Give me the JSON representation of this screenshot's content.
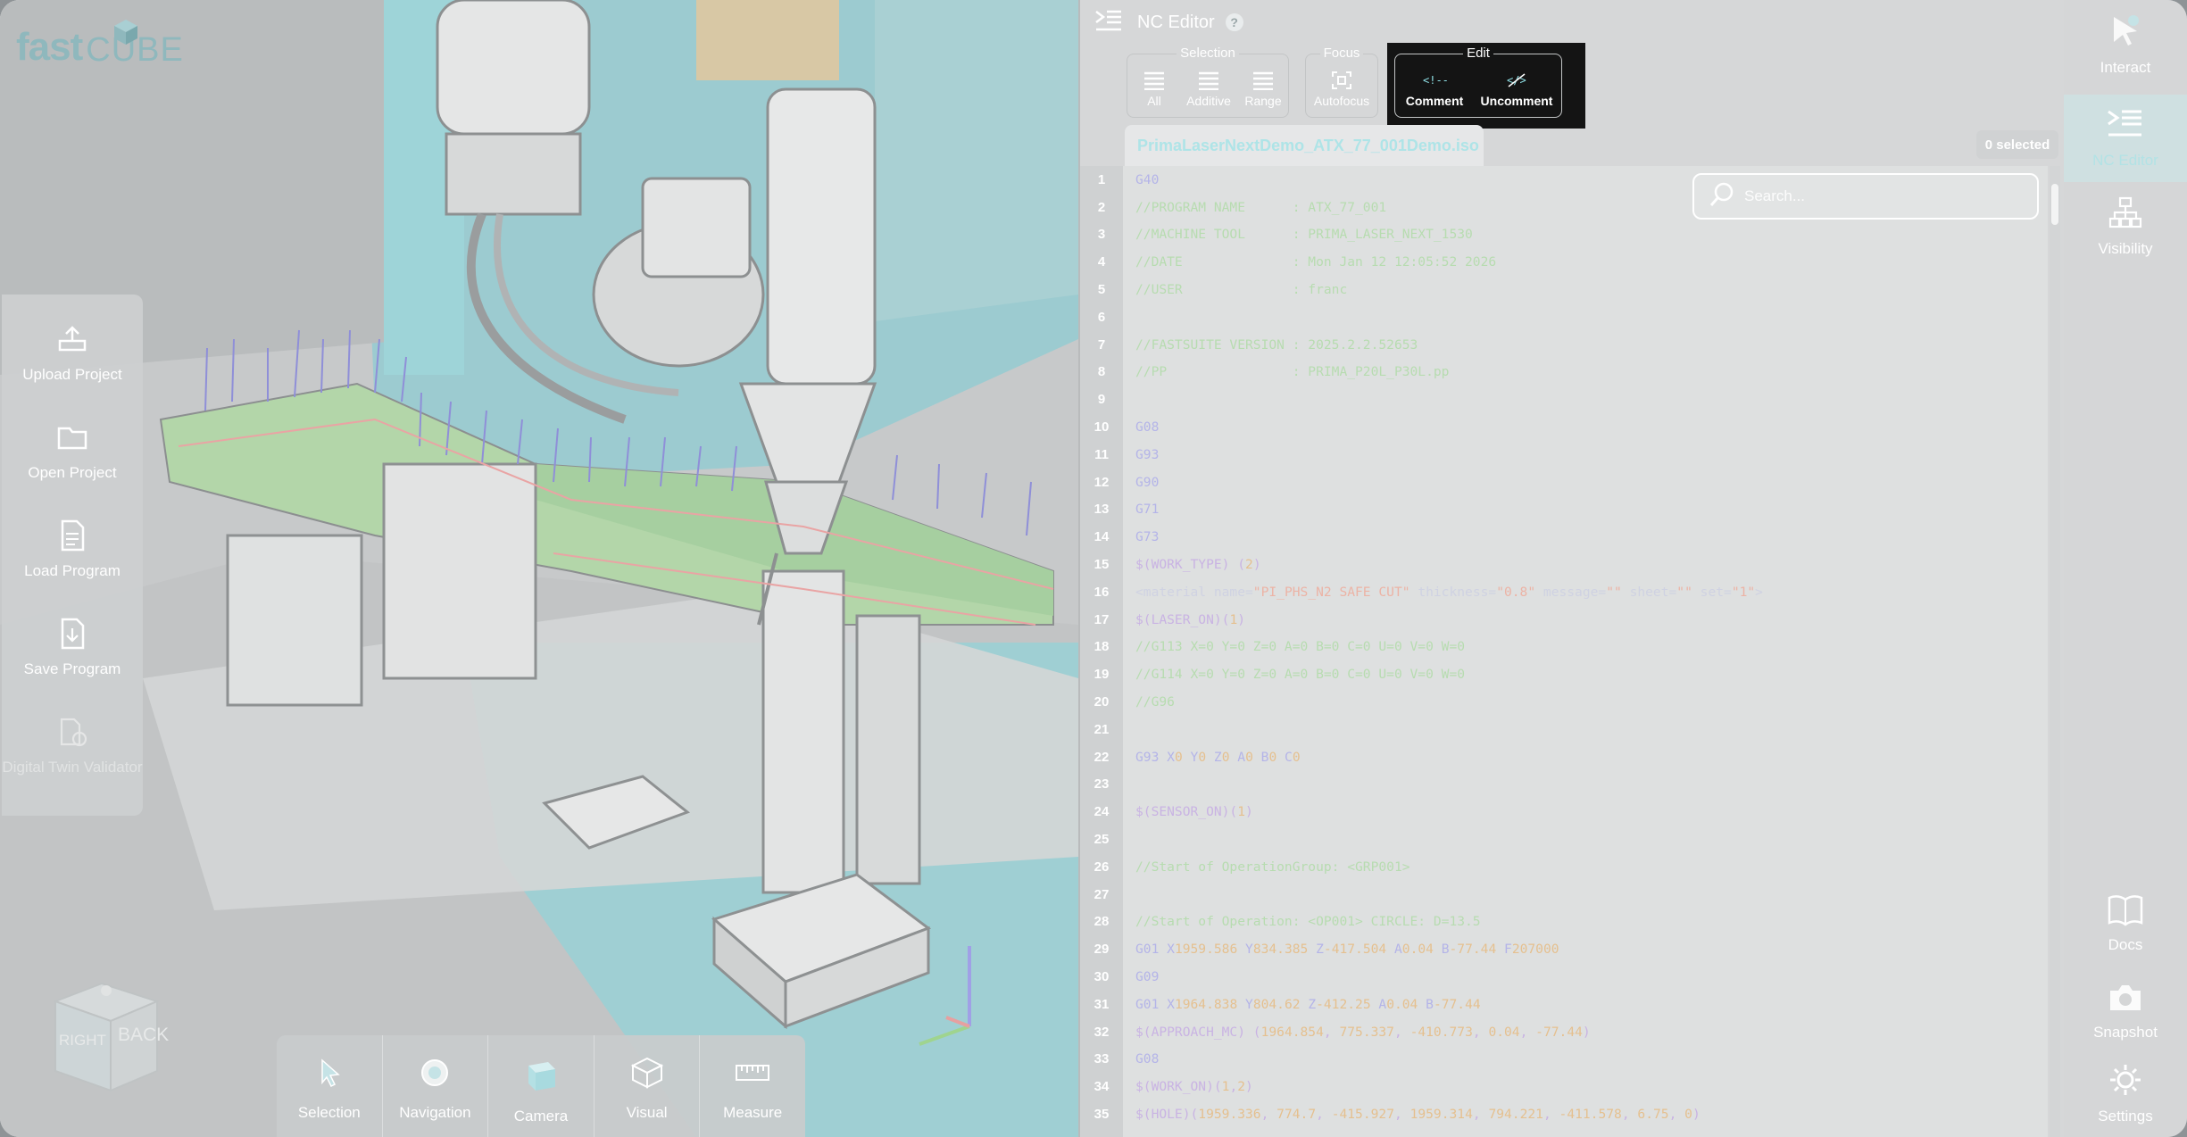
{
  "app": {
    "brand_fast": "fast",
    "brand_cube": "CUBE"
  },
  "left_toolbar": [
    {
      "label": "Upload Project",
      "icon": "upload-project-icon",
      "enabled": true
    },
    {
      "label": "Open Project",
      "icon": "folder-icon",
      "enabled": true
    },
    {
      "label": "Load Program",
      "icon": "document-icon",
      "enabled": true
    },
    {
      "label": "Save Program",
      "icon": "save-document-icon",
      "enabled": true
    },
    {
      "label": "Digital Twin Validator",
      "icon": "digital-twin-icon",
      "enabled": false
    }
  ],
  "viewcube": {
    "left_face": "RIGHT",
    "right_face": "BACK"
  },
  "bottom_toolbar": [
    {
      "label": "Selection",
      "icon": "cursor-icon"
    },
    {
      "label": "Navigation",
      "icon": "navigation-icon"
    },
    {
      "label": "Camera",
      "icon": "camera-cube-icon"
    },
    {
      "label": "Visual",
      "icon": "visual-cube-icon"
    },
    {
      "label": "Measure",
      "icon": "measure-icon"
    }
  ],
  "editor": {
    "title": "NC Editor",
    "help": "?",
    "groups": {
      "selection": {
        "title": "Selection",
        "buttons": [
          "All",
          "Additive",
          "Range"
        ]
      },
      "focus": {
        "title": "Focus",
        "buttons": [
          "Autofocus"
        ]
      },
      "edit": {
        "title": "Edit",
        "buttons": [
          "Comment",
          "Uncomment"
        ]
      }
    },
    "file_tab": "PrimaLaserNextDemo_ATX_77_001Demo.iso",
    "selected_badge": "0 selected",
    "search_placeholder": "Search..."
  },
  "code_lines": [
    [
      [
        "kw",
        "G40"
      ]
    ],
    [
      [
        "com",
        "//PROGRAM NAME      : ATX_77_001"
      ]
    ],
    [
      [
        "com",
        "//MACHINE TOOL      : PRIMA_LASER_NEXT_1530"
      ]
    ],
    [
      [
        "com",
        "//DATE              : Mon Jan 12 12:05:52 2026"
      ]
    ],
    [
      [
        "com",
        "//USER              : franc"
      ]
    ],
    [],
    [
      [
        "com",
        "//FASTSUITE VERSION : 2025.2.2.52653"
      ]
    ],
    [
      [
        "com",
        "//PP                : PRIMA_P20L_P30L.pp"
      ]
    ],
    [],
    [
      [
        "kw",
        "G08"
      ]
    ],
    [
      [
        "kw",
        "G93"
      ]
    ],
    [
      [
        "kw",
        "G90"
      ]
    ],
    [
      [
        "kw",
        "G71"
      ]
    ],
    [
      [
        "kw",
        "G73"
      ]
    ],
    [
      [
        "mac",
        "$(WORK_TYPE) ("
      ],
      [
        "num",
        "2"
      ],
      [
        "mac",
        ")"
      ]
    ],
    [
      [
        "txt",
        "<material name="
      ],
      [
        "str",
        "\"PI_PHS_N2 SAFE CUT\""
      ],
      [
        "txt",
        " thickness="
      ],
      [
        "str",
        "\"0.8\""
      ],
      [
        "txt",
        " message="
      ],
      [
        "str",
        "\"\""
      ],
      [
        "txt",
        " sheet="
      ],
      [
        "str",
        "\"\""
      ],
      [
        "txt",
        " set="
      ],
      [
        "str",
        "\"1\""
      ],
      [
        "txt",
        ">"
      ]
    ],
    [
      [
        "mac",
        "$(LASER_ON)("
      ],
      [
        "num",
        "1"
      ],
      [
        "mac",
        ")"
      ]
    ],
    [
      [
        "com",
        "//G113 X=0 Y=0 Z=0 A=0 B=0 C=0 U=0 V=0 W=0"
      ]
    ],
    [
      [
        "com",
        "//G114 X=0 Y=0 Z=0 A=0 B=0 C=0 U=0 V=0 W=0"
      ]
    ],
    [
      [
        "com",
        "//G96"
      ]
    ],
    [],
    [
      [
        "kw",
        "G93 X"
      ],
      [
        "num",
        "0"
      ],
      [
        "kw",
        " Y"
      ],
      [
        "num",
        "0"
      ],
      [
        "kw",
        " Z"
      ],
      [
        "num",
        "0"
      ],
      [
        "kw",
        " A"
      ],
      [
        "num",
        "0"
      ],
      [
        "kw",
        " B"
      ],
      [
        "num",
        "0"
      ],
      [
        "kw",
        " C"
      ],
      [
        "num",
        "0"
      ]
    ],
    [],
    [
      [
        "mac",
        "$(SENSOR_ON)("
      ],
      [
        "num",
        "1"
      ],
      [
        "mac",
        ")"
      ]
    ],
    [],
    [
      [
        "com",
        "//Start of OperationGroup: <GRP001>"
      ]
    ],
    [],
    [
      [
        "com",
        "//Start of Operation: <OP001> CIRCLE: D=13.5"
      ]
    ],
    [
      [
        "kw",
        "G01 X"
      ],
      [
        "num",
        "1959.586"
      ],
      [
        "kw",
        " Y"
      ],
      [
        "num",
        "834.385"
      ],
      [
        "kw",
        " Z"
      ],
      [
        "num",
        "-417.504"
      ],
      [
        "kw",
        " A"
      ],
      [
        "num",
        "0.04"
      ],
      [
        "kw",
        " B"
      ],
      [
        "num",
        "-77.44"
      ],
      [
        "kw",
        " F"
      ],
      [
        "num",
        "207000"
      ]
    ],
    [
      [
        "kw",
        "G09"
      ]
    ],
    [
      [
        "kw",
        "G01 X"
      ],
      [
        "num",
        "1964.838"
      ],
      [
        "kw",
        " Y"
      ],
      [
        "num",
        "804.62"
      ],
      [
        "kw",
        " Z"
      ],
      [
        "num",
        "-412.25"
      ],
      [
        "kw",
        " A"
      ],
      [
        "num",
        "0.04"
      ],
      [
        "kw",
        " B"
      ],
      [
        "num",
        "-77.44"
      ]
    ],
    [
      [
        "mac",
        "$(APPROACH_MC) ("
      ],
      [
        "num",
        "1964.854"
      ],
      [
        "mac",
        ", "
      ],
      [
        "num",
        "775.337"
      ],
      [
        "mac",
        ", "
      ],
      [
        "num",
        "-410.773"
      ],
      [
        "mac",
        ", "
      ],
      [
        "num",
        "0.04"
      ],
      [
        "mac",
        ", "
      ],
      [
        "num",
        "-77.44"
      ],
      [
        "mac",
        ")"
      ]
    ],
    [
      [
        "kw",
        "G08"
      ]
    ],
    [
      [
        "mac",
        "$(WORK_ON)("
      ],
      [
        "num",
        "1"
      ],
      [
        "mac",
        ","
      ],
      [
        "num",
        "2"
      ],
      [
        "mac",
        ")"
      ]
    ],
    [
      [
        "mac",
        "$(HOLE)("
      ],
      [
        "num",
        "1959.336"
      ],
      [
        "mac",
        ", "
      ],
      [
        "num",
        "774.7"
      ],
      [
        "mac",
        ", "
      ],
      [
        "num",
        "-415.927"
      ],
      [
        "mac",
        ", "
      ],
      [
        "num",
        "1959.314"
      ],
      [
        "mac",
        ", "
      ],
      [
        "num",
        "794.221"
      ],
      [
        "mac",
        ", "
      ],
      [
        "num",
        "-411.578"
      ],
      [
        "mac",
        ", "
      ],
      [
        "num",
        "6.75"
      ],
      [
        "mac",
        ", "
      ],
      [
        "num",
        "0"
      ],
      [
        "mac",
        ")"
      ]
    ]
  ],
  "sidebar": {
    "top": [
      {
        "label": "Interact",
        "icon": "interact-cursor-icon"
      },
      {
        "label": "NC Editor",
        "icon": "nc-editor-icon",
        "active": true
      },
      {
        "label": "Visibility",
        "icon": "visibility-tree-icon"
      }
    ],
    "bottom": [
      {
        "label": "Docs",
        "icon": "book-icon"
      },
      {
        "label": "Snapshot",
        "icon": "camera-icon"
      },
      {
        "label": "Settings",
        "icon": "gear-icon"
      }
    ]
  },
  "colors": {
    "accent": "#b2e2e5",
    "comment": "#b7dcb0",
    "keyword": "#b4b4e8",
    "number": "#e5c08f"
  }
}
